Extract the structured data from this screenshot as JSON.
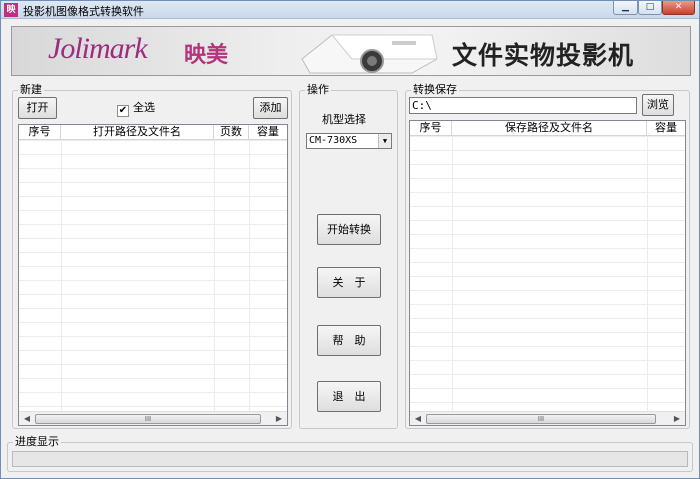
{
  "window": {
    "title": "投影机图像格式转换软件",
    "app_icon_text": "映"
  },
  "banner": {
    "logo_text": "Jolimark",
    "logo_cn": "映美",
    "slogan": "文件实物投影机"
  },
  "new_group": {
    "label": "新建",
    "open_button": "打开",
    "select_all_label": "全选",
    "select_all_checked": true,
    "add_button": "添加",
    "columns": [
      "序号",
      "打开路径及文件名",
      "页数",
      "容量"
    ],
    "rows": []
  },
  "operation_group": {
    "label": "操作",
    "model_label": "机型选择",
    "model_selected": "CM-730XS",
    "start_button": "开始转换",
    "about_button": "关　于",
    "help_button": "帮　助",
    "exit_button": "退　出"
  },
  "save_group": {
    "label": "转换保存",
    "path_value": "C:\\",
    "browse_button": "浏览",
    "columns": [
      "序号",
      "保存路径及文件名",
      "容量"
    ],
    "rows": []
  },
  "progress_group": {
    "label": "进度显示",
    "progress": 0
  },
  "colors": {
    "brand": "#9b2c7f",
    "window_border": "#6d8fb8",
    "close_button": "#c7432d"
  }
}
